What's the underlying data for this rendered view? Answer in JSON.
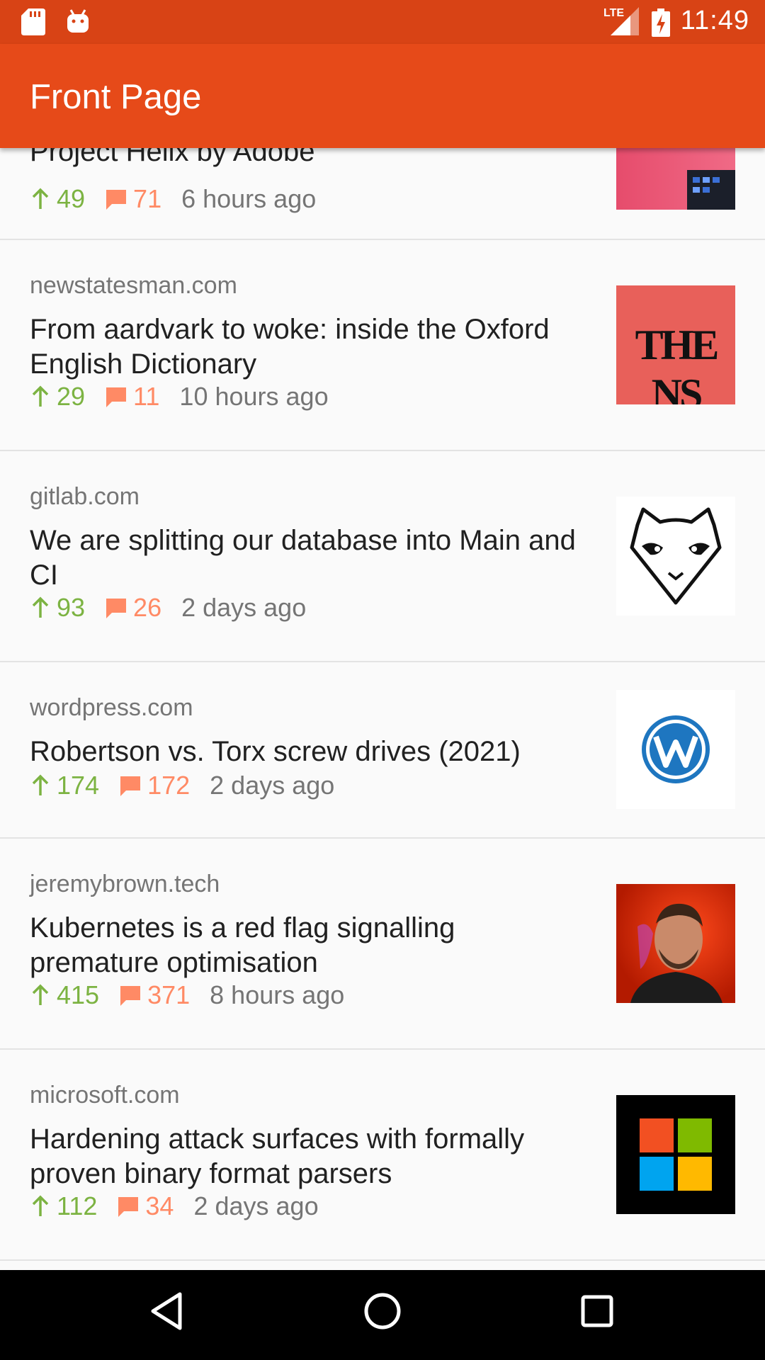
{
  "status_bar": {
    "time": "11:49",
    "icons": [
      "sd-card-icon",
      "android-debug-icon",
      "lte-signal-icon",
      "battery-charging-icon"
    ],
    "network_label": "LTE"
  },
  "app_bar": {
    "title": "Front Page"
  },
  "colors": {
    "status_bar": "#d84315",
    "app_bar": "#e64a19",
    "points": "#7cb342",
    "comments": "#ff8a65",
    "muted_text": "#757575"
  },
  "items": [
    {
      "domain": "",
      "title": "Project Helix by Adobe",
      "points": "49",
      "comments": "71",
      "age": "6 hours ago",
      "thumb": "adobe-helix-thumbnail"
    },
    {
      "domain": "newstatesman.com",
      "title": "From aardvark to woke: inside the Oxford English Dictionary",
      "points": "29",
      "comments": "11",
      "age": "10 hours ago",
      "thumb": "new-statesman-logo",
      "thumb_text": "THE NS"
    },
    {
      "domain": "gitlab.com",
      "title": "We are splitting our database into Main and CI",
      "points": "93",
      "comments": "26",
      "age": "2 days ago",
      "thumb": "gitlab-logo"
    },
    {
      "domain": "wordpress.com",
      "title": "Robertson vs. Torx screw drives (2021)",
      "points": "174",
      "comments": "172",
      "age": "2 days ago",
      "thumb": "wordpress-logo"
    },
    {
      "domain": "jeremybrown.tech",
      "title": "Kubernetes is a red flag signalling premature optimisation",
      "points": "415",
      "comments": "371",
      "age": "8 hours ago",
      "thumb": "author-portrait"
    },
    {
      "domain": "microsoft.com",
      "title": "Hardening attack surfaces with formally proven binary format parsers",
      "points": "112",
      "comments": "34",
      "age": "2 days ago",
      "thumb": "microsoft-logo"
    }
  ],
  "nav_bar": {
    "buttons": [
      "back-icon",
      "home-icon",
      "recents-icon"
    ]
  }
}
